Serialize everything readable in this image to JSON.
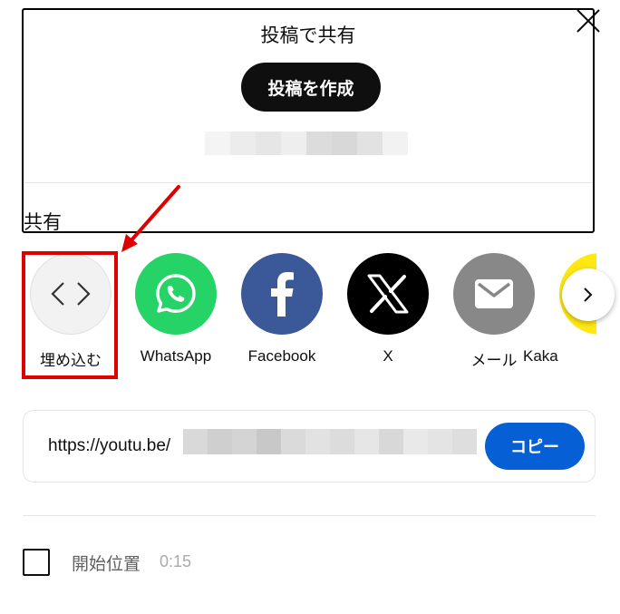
{
  "post_section": {
    "title": "投稿で共有",
    "create_post_label": "投稿を作成"
  },
  "share_section": {
    "heading": "共有",
    "items": [
      {
        "label": "埋め込む",
        "icon": "embed-code-icon",
        "color": "#f2f2f2"
      },
      {
        "label": "WhatsApp",
        "icon": "whatsapp-icon",
        "color": "#25d366"
      },
      {
        "label": "Facebook",
        "icon": "facebook-icon",
        "color": "#3b5998"
      },
      {
        "label": "X",
        "icon": "x-logo-icon",
        "color": "#000000"
      },
      {
        "label": "メール",
        "icon": "mail-icon",
        "color": "#888888"
      },
      {
        "label": "Kaka",
        "icon": "kakaotalk-icon",
        "color": "#ffe812"
      }
    ]
  },
  "link": {
    "url_prefix": "https://youtu.be/",
    "copy_label": "コピー"
  },
  "start_at": {
    "label": "開始位置",
    "time": "0:15",
    "checked": false
  },
  "colors": {
    "accent": "#065fd4",
    "highlight": "#e00000"
  }
}
